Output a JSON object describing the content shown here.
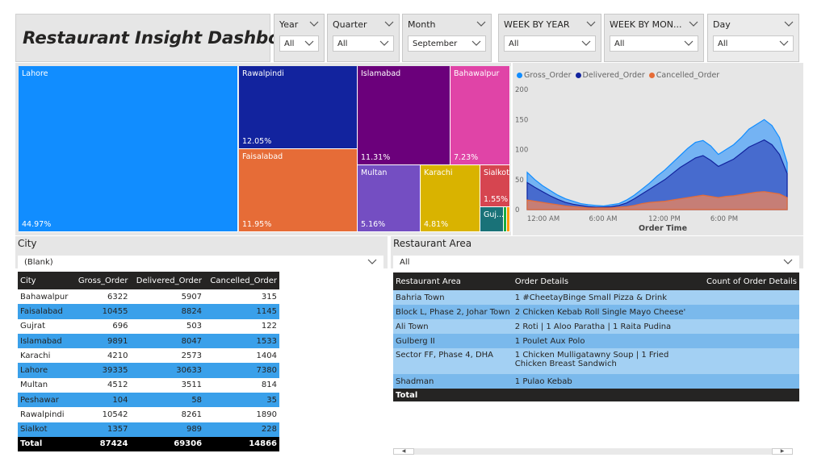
{
  "title": "Restaurant Insight Dashboard",
  "slicers": [
    {
      "name": "Year",
      "value": "All"
    },
    {
      "name": "Quarter",
      "value": "All"
    },
    {
      "name": "Month",
      "value": "September"
    },
    {
      "name": "WEEK BY YEAR",
      "value": "All"
    },
    {
      "name": "WEEK BY MON...",
      "value": "All"
    },
    {
      "name": "Day",
      "value": "All"
    }
  ],
  "city_filter": {
    "label": "City",
    "value": "(Blank)"
  },
  "area_filter": {
    "label": "Restaurant Area",
    "value": "All"
  },
  "chart_data": [
    {
      "type": "treemap",
      "items": [
        {
          "name": "Lahore",
          "pct": "44.97%",
          "color": "#118dff"
        },
        {
          "name": "Rawalpindi",
          "pct": "12.05%",
          "color": "#12239e"
        },
        {
          "name": "Faisalabad",
          "pct": "11.95%",
          "color": "#e66c37"
        },
        {
          "name": "Islamabad",
          "pct": "11.31%",
          "color": "#6b007b"
        },
        {
          "name": "Bahawalpur",
          "pct": "7.23%",
          "color": "#e044a7"
        },
        {
          "name": "Multan",
          "pct": "5.16%",
          "color": "#744ec2"
        },
        {
          "name": "Karachi",
          "pct": "4.81%",
          "color": "#d9b300"
        },
        {
          "name": "Sialkot",
          "pct": "1.55%",
          "color": "#d64550"
        },
        {
          "name": "Guj...",
          "pct": "",
          "color": "#197278"
        }
      ]
    },
    {
      "type": "area",
      "legend": [
        "Gross_Order",
        "Delivered_Order",
        "Cancelled_Order"
      ],
      "colors": [
        "#118dff",
        "#12239e",
        "#e66c37"
      ],
      "xlabel": "Order Time",
      "x_ticks": [
        "12:00 AM",
        "6:00 AM",
        "12:00 PM",
        "6:00 PM"
      ],
      "y_ticks": [
        0,
        50,
        100,
        150,
        200
      ],
      "ylim": [
        0,
        200
      ],
      "series": [
        {
          "name": "Gross_Order",
          "values": [
            62,
            50,
            40,
            32,
            24,
            18,
            14,
            10,
            8,
            7,
            6,
            8,
            10,
            16,
            24,
            34,
            44,
            56,
            66,
            78,
            90,
            102,
            112,
            115,
            106,
            92,
            100,
            108,
            120,
            134,
            142,
            150,
            140,
            120,
            78
          ]
        },
        {
          "name": "Delivered_Order",
          "values": [
            45,
            37,
            30,
            23,
            17,
            12,
            9,
            7,
            5,
            4,
            4,
            5,
            7,
            11,
            18,
            26,
            34,
            42,
            50,
            60,
            70,
            78,
            86,
            90,
            82,
            72,
            78,
            84,
            94,
            104,
            110,
            116,
            108,
            92,
            60
          ]
        },
        {
          "name": "Cancelled_Order",
          "values": [
            16,
            14,
            12,
            10,
            8,
            6,
            5,
            4,
            3,
            3,
            3,
            3,
            4,
            5,
            7,
            10,
            12,
            13,
            14,
            16,
            18,
            20,
            22,
            24,
            22,
            20,
            22,
            23,
            25,
            27,
            29,
            30,
            28,
            26,
            20
          ]
        }
      ]
    }
  ],
  "city_table": {
    "headers": [
      "City",
      "Gross_Order",
      "Delivered_Order",
      "Cancelled_Order"
    ],
    "rows": [
      [
        "Bahawalpur",
        "6322",
        "5907",
        "315"
      ],
      [
        "Faisalabad",
        "10455",
        "8824",
        "1145"
      ],
      [
        "Gujrat",
        "696",
        "503",
        "122"
      ],
      [
        "Islamabad",
        "9891",
        "8047",
        "1533"
      ],
      [
        "Karachi",
        "4210",
        "2573",
        "1404"
      ],
      [
        "Lahore",
        "39335",
        "30633",
        "7380"
      ],
      [
        "Multan",
        "4512",
        "3511",
        "814"
      ],
      [
        "Peshawar",
        "104",
        "58",
        "35"
      ],
      [
        "Rawalpindi",
        "10542",
        "8261",
        "1890"
      ],
      [
        "Sialkot",
        "1357",
        "989",
        "228"
      ]
    ],
    "total": [
      "Total",
      "87424",
      "69306",
      "14866"
    ]
  },
  "area_table": {
    "headers": [
      "Restaurant Area",
      "Order Details",
      "Count of Order Details"
    ],
    "rows": [
      [
        "Bahria Town",
        "1 #CheetayBinge Small Pizza & Drink",
        ""
      ],
      [
        "Block L, Phase 2, Johar Town",
        "2 Chicken Kebab Roll Single Mayo Cheese'",
        ""
      ],
      [
        "Ali Town",
        "2 Roti | 1 Aloo Paratha | 1 Raita Pudina",
        ""
      ],
      [
        "Gulberg II",
        "1 Poulet Aux Polo",
        ""
      ],
      [
        "Sector FF, Phase 4, DHA",
        "1 Chicken Mulligatawny Soup | 1 Fried Chicken Breast Sandwich",
        ""
      ],
      [
        "Shadman",
        "1 Pulao Kebab",
        ""
      ]
    ],
    "total": [
      "Total",
      "",
      ""
    ]
  }
}
